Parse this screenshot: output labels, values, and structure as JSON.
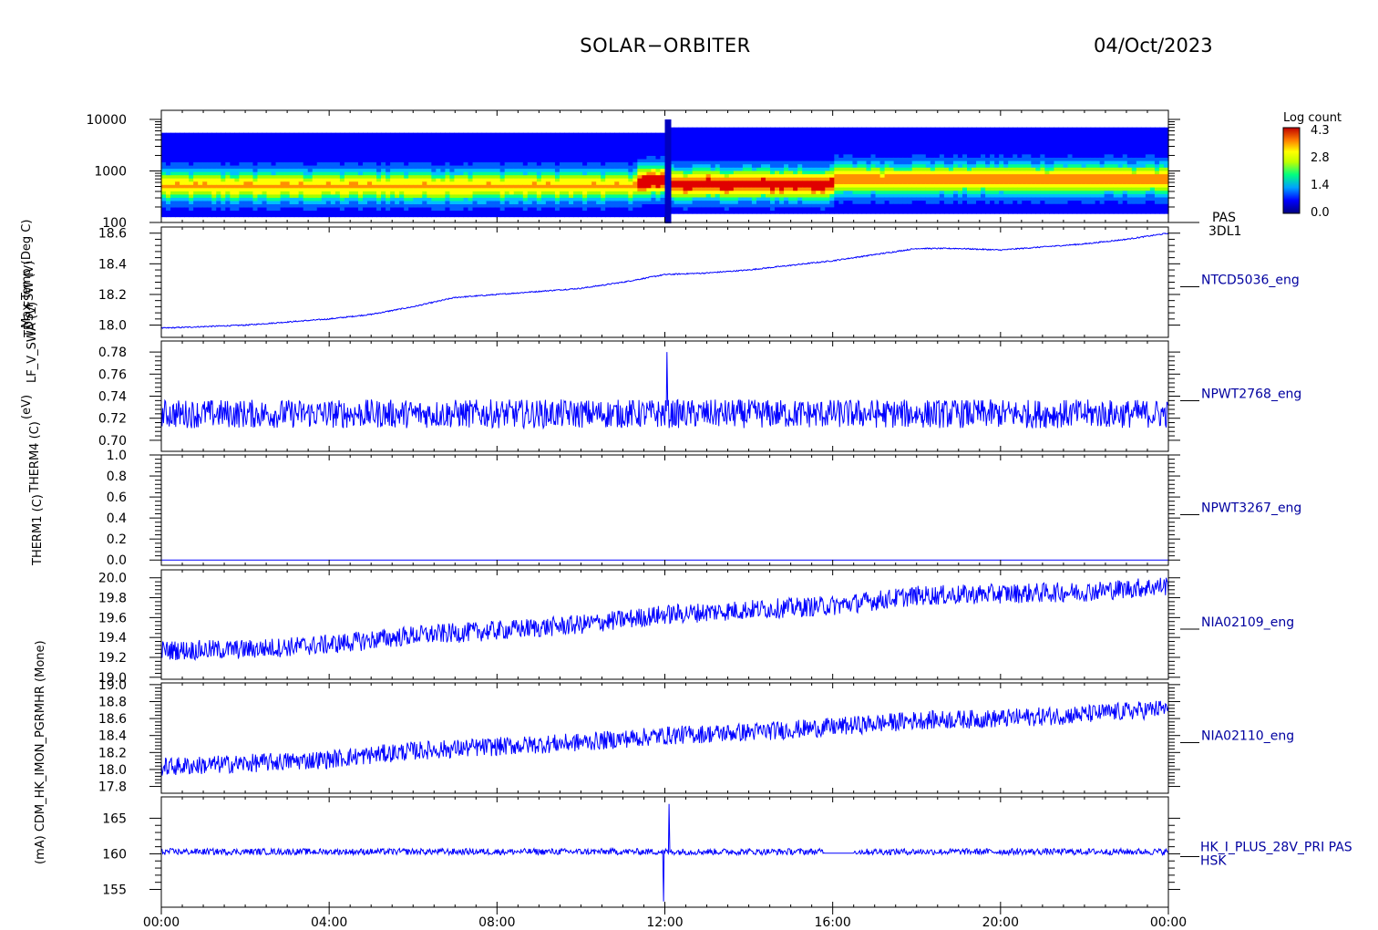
{
  "header": {
    "title": "SOLAR−ORBITER",
    "date": "04/Oct/2023"
  },
  "x_axis": {
    "ticks": [
      "00:00",
      "04:00",
      "08:00",
      "12:00",
      "16:00",
      "20:00",
      "00:00"
    ],
    "range_hours": [
      0,
      24
    ]
  },
  "y_titles": [
    "(eV)",
    "Max Temp (Deg C)",
    "TDS_FSW (V)",
    "LF_V_SWA (V)",
    "THERM4 (C)",
    "THERM1 (C)",
    "(mA) CDM_HK_IMON_PGRMHR (Mone)"
  ],
  "colorbar": {
    "title": "Log count",
    "ticks": [
      "4.3",
      "2.8",
      "1.4",
      "0.0"
    ],
    "range": [
      0.0,
      4.3
    ]
  },
  "chart_data": [
    {
      "type": "heatmap",
      "panel": "PAS energy spectrogram",
      "label_lines": [
        "PAS",
        "3DL1"
      ],
      "ylabel": "(eV)",
      "y_scale": "log",
      "ylim": [
        100,
        15000
      ],
      "yticks": [
        "10000",
        "1000",
        "100"
      ],
      "ytick_values": [
        10000,
        1000,
        100
      ],
      "energy_range_before_1205": [
        130,
        5500
      ],
      "energy_range_after_1205": [
        150,
        7000
      ],
      "peak_energy_segments": [
        {
          "t_start": 0.0,
          "t_end": 11.4,
          "peak_eV": 520,
          "log_count": 3.0
        },
        {
          "t_start": 11.4,
          "t_end": 12.0,
          "peak_eV": 650,
          "log_count": 4.0
        },
        {
          "t_start": 12.0,
          "t_end": 16.0,
          "peak_eV": 560,
          "log_count": 3.8
        },
        {
          "t_start": 16.0,
          "t_end": 24.0,
          "peak_eV": 700,
          "log_count": 3.3
        }
      ]
    },
    {
      "type": "line",
      "label": "NTCD5036_eng",
      "ylabel": "Max Temp (Deg C)",
      "ylim": [
        17.92,
        18.64
      ],
      "yticks": [
        "18.6",
        "18.4",
        "18.2",
        "18.0"
      ],
      "ytick_values": [
        18.6,
        18.4,
        18.2,
        18.0
      ],
      "x": [
        0,
        1,
        2,
        3,
        4,
        5,
        6,
        7,
        8,
        9,
        10,
        11,
        12,
        13,
        14,
        15,
        16,
        17,
        18,
        19,
        20,
        21,
        22,
        23,
        24
      ],
      "y": [
        17.98,
        17.99,
        18.0,
        18.02,
        18.04,
        18.07,
        18.12,
        18.18,
        18.2,
        18.22,
        18.24,
        18.28,
        18.33,
        18.34,
        18.36,
        18.39,
        18.42,
        18.46,
        18.5,
        18.5,
        18.49,
        18.51,
        18.53,
        18.56,
        18.6
      ],
      "noise_amplitude": 0.004
    },
    {
      "type": "line",
      "label": "NPWT2768_eng",
      "ylabel": "TDS_FSW (V)",
      "ylim": [
        0.69,
        0.79
      ],
      "yticks": [
        "0.78",
        "0.76",
        "0.74",
        "0.72",
        "0.70"
      ],
      "ytick_values": [
        0.78,
        0.76,
        0.74,
        0.72,
        0.7
      ],
      "x": [
        0,
        24
      ],
      "y": [
        0.724,
        0.724
      ],
      "noise_amplitude": 0.013,
      "spikes": [
        {
          "x": 12.05,
          "y": 0.78
        }
      ]
    },
    {
      "type": "line",
      "label": "NPWT3267_eng",
      "ylabel": "LF_V_SWA (V)",
      "ylim": [
        -0.05,
        1.0
      ],
      "yticks": [
        "1.0",
        "0.8",
        "0.6",
        "0.4",
        "0.2",
        "0.0"
      ],
      "ytick_values": [
        1.0,
        0.8,
        0.6,
        0.4,
        0.2,
        0.0
      ],
      "x": [
        0,
        24
      ],
      "y": [
        0.0,
        0.0
      ],
      "noise_amplitude": 0
    },
    {
      "type": "line",
      "label": "NIA02109_eng",
      "ylabel": "THERM4 (C)",
      "ylim": [
        18.98,
        20.08
      ],
      "yticks": [
        "20.0",
        "19.8",
        "19.6",
        "19.4",
        "19.2",
        "19.0"
      ],
      "ytick_values": [
        20.0,
        19.8,
        19.6,
        19.4,
        19.2,
        19.0
      ],
      "x": [
        0,
        2,
        4,
        6,
        8,
        10,
        12,
        14,
        16,
        18,
        20,
        22,
        24
      ],
      "y": [
        19.27,
        19.28,
        19.33,
        19.42,
        19.47,
        19.53,
        19.63,
        19.68,
        19.72,
        19.82,
        19.84,
        19.86,
        19.92
      ],
      "noise_amplitude": 0.1
    },
    {
      "type": "line",
      "label": "NIA02110_eng",
      "ylabel": "THERM1 (C)",
      "ylim": [
        17.72,
        19.02
      ],
      "yticks": [
        "19.0",
        "18.8",
        "18.6",
        "18.4",
        "18.2",
        "18.0",
        "17.8"
      ],
      "ytick_values": [
        19.0,
        18.8,
        18.6,
        18.4,
        18.2,
        18.0,
        17.8
      ],
      "x": [
        0,
        2,
        4,
        6,
        8,
        10,
        12,
        14,
        16,
        18,
        20,
        22,
        24
      ],
      "y": [
        18.03,
        18.07,
        18.12,
        18.22,
        18.27,
        18.32,
        18.4,
        18.44,
        18.5,
        18.58,
        18.6,
        18.65,
        18.72
      ],
      "noise_amplitude": 0.11
    },
    {
      "type": "line",
      "label_lines": [
        "HK_I_PLUS_28V_PRI PAS",
        "HSK"
      ],
      "ylabel": "(mA) CDM_HK_IMON_PGRMHR (Mone)",
      "ylim": [
        152.5,
        168.0
      ],
      "yticks": [
        "165",
        "160",
        "155"
      ],
      "ytick_values": [
        165,
        160,
        155
      ],
      "x": [
        0,
        24
      ],
      "y": [
        160.3,
        160.3
      ],
      "noise_amplitude": 0.45,
      "spikes": [
        {
          "x": 11.97,
          "y": 153.3
        },
        {
          "x": 12.1,
          "y": 167.0
        }
      ],
      "gap": [
        15.8,
        16.5
      ]
    }
  ]
}
